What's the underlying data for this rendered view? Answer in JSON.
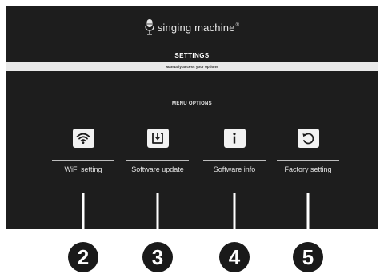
{
  "brand": {
    "name": "singing machine",
    "reg": "®"
  },
  "settings": {
    "title": "SETTINGS",
    "subtitle": "Manually access your options"
  },
  "menu": {
    "heading": "MENU OPTIONS",
    "options": [
      {
        "label": "WiFi setting",
        "icon": "wifi-icon"
      },
      {
        "label": "Software update",
        "icon": "download-icon"
      },
      {
        "label": "Software info",
        "icon": "info-icon"
      },
      {
        "label": "Factory setting",
        "icon": "reset-icon"
      }
    ]
  },
  "callouts": [
    "2",
    "3",
    "4",
    "5"
  ],
  "colors": {
    "screen_bg": "#1d1d1d",
    "subbar_bg": "#e9e9e9",
    "icon_bg": "#f2f2f2",
    "callout": "#1a1a1a"
  }
}
